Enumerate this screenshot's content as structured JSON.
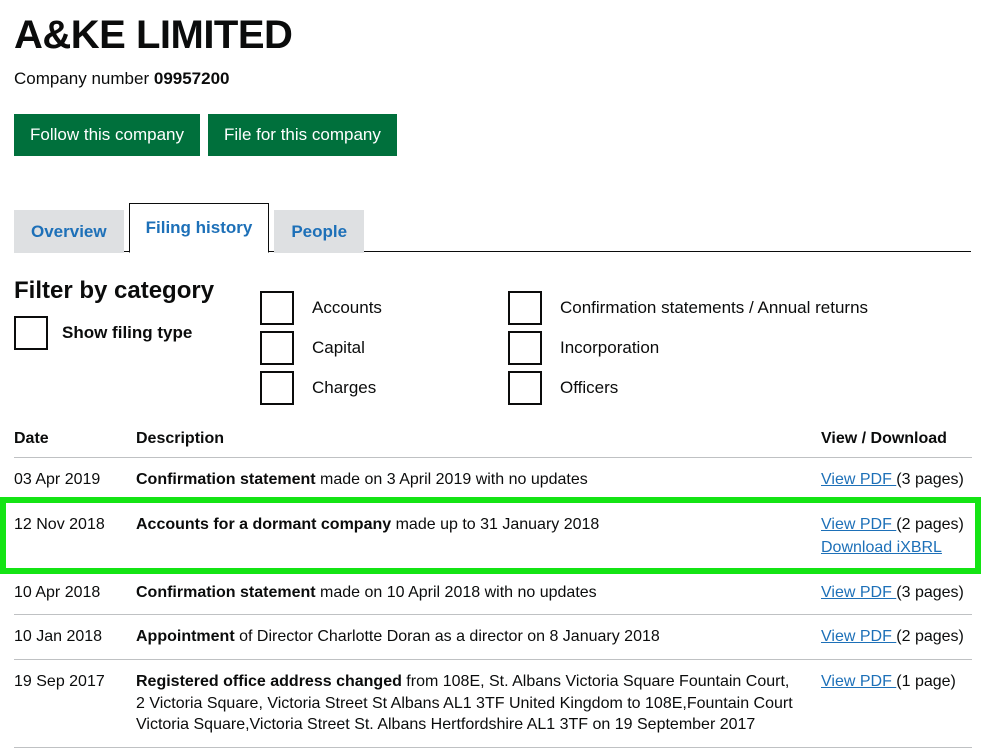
{
  "company": {
    "name": "A&KE LIMITED",
    "number_label": "Company number",
    "number": "09957200"
  },
  "actions": {
    "follow_label": "Follow this company",
    "file_label": "File for this company"
  },
  "tabs": [
    {
      "label": "Overview",
      "selected": false
    },
    {
      "label": "Filing history",
      "selected": true
    },
    {
      "label": "People",
      "selected": false
    }
  ],
  "filter": {
    "heading": "Filter by category",
    "show_filing_type_label": "Show filing type",
    "categories_col1": [
      "Accounts",
      "Capital",
      "Charges"
    ],
    "categories_col2": [
      "Confirmation statements / Annual returns",
      "Incorporation",
      "Officers"
    ]
  },
  "table": {
    "headers": {
      "date": "Date",
      "description": "Description",
      "view": "View / Download"
    },
    "rows": [
      {
        "date": "03 Apr 2019",
        "desc_type": "Confirmation statement",
        "desc_rest": " made on 3 April 2019 with no updates",
        "links": [
          {
            "text": "View PDF ",
            "pages": "(3 pages)"
          }
        ],
        "highlighted": false
      },
      {
        "date": "12 Nov 2018",
        "desc_type": "Accounts for a dormant company",
        "desc_rest": " made up to 31 January 2018",
        "links": [
          {
            "text": "View PDF ",
            "pages": "(2 pages)"
          },
          {
            "text": "Download iXBRL",
            "pages": ""
          }
        ],
        "highlighted": true
      },
      {
        "date": "10 Apr 2018",
        "desc_type": "Confirmation statement",
        "desc_rest": " made on 10 April 2018 with no updates",
        "links": [
          {
            "text": "View PDF ",
            "pages": "(3 pages)"
          }
        ],
        "highlighted": false
      },
      {
        "date": "10 Jan 2018",
        "desc_type": "Appointment",
        "desc_rest": " of Director Charlotte Doran as a director on 8 January 2018",
        "links": [
          {
            "text": "View PDF ",
            "pages": "(2 pages)"
          }
        ],
        "highlighted": false
      },
      {
        "date": "19 Sep 2017",
        "desc_type": "Registered office address changed",
        "desc_rest": " from 108E, St. Albans Victoria Square Fountain Court, 2 Victoria Square, Victoria Street St Albans AL1 3TF United Kingdom to 108E,Fountain Court Victoria Square,Victoria Street St. Albans Hertfordshire AL1 3TF on 19 September 2017",
        "links": [
          {
            "text": "View PDF ",
            "pages": "(1 page)"
          }
        ],
        "highlighted": false
      }
    ]
  },
  "colors": {
    "brand_green": "#00703c",
    "highlight_green": "#14e414",
    "link_blue": "#1d70b8",
    "tab_grey": "#dee0e2",
    "rule_grey": "#bfc1c3"
  }
}
